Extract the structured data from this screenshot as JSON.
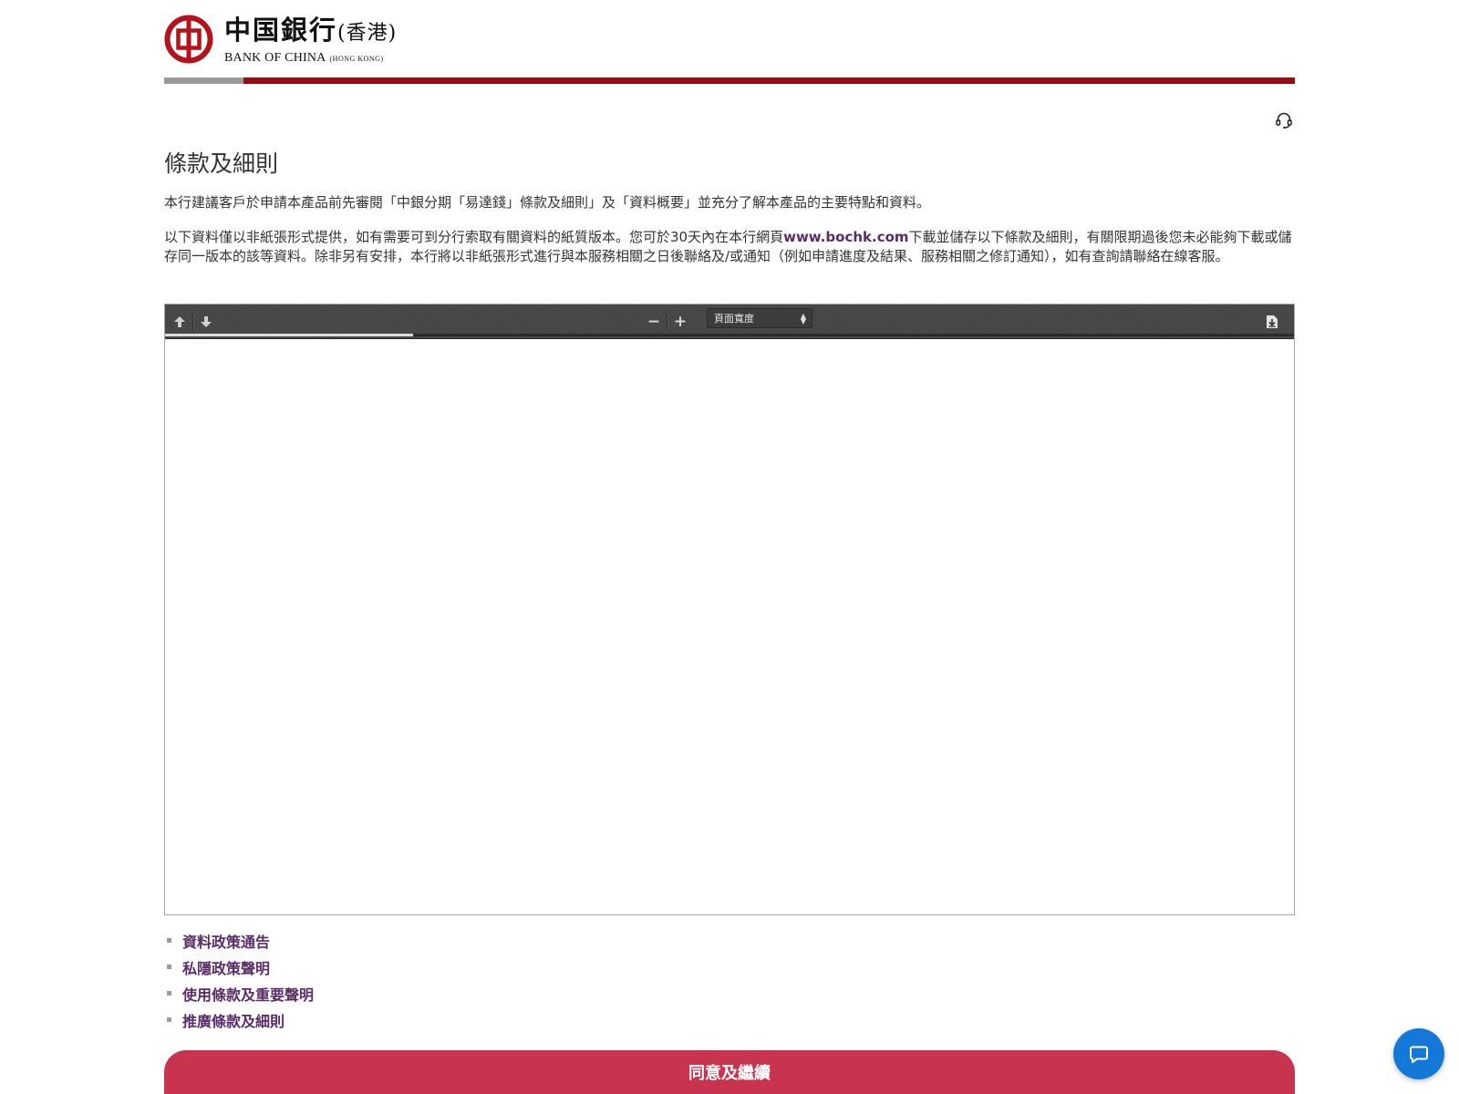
{
  "header": {
    "brand_cn": "中国銀行",
    "brand_cn_region": "(香港)",
    "brand_en": "BANK OF CHINA",
    "brand_en_region": "(HONG KONG)",
    "progress_fraction": 0.07
  },
  "page": {
    "title": "條款及細則",
    "intro": "本行建議客戶於申請本產品前先審閱「中銀分期「易達錢」條款及細則」及「資料概要」並充分了解本產品的主要特點和資料。",
    "notice_before_link": "以下資料僅以非紙張形式提供，如有需要可到分行索取有關資料的紙質版本。您可於30天內在本行網頁",
    "notice_link": "www.bochk.com",
    "notice_after_link": "下載並儲存以下條款及細則，有關限期過後您未必能夠下載或儲存同一版本的該等資料。除非另有安排，本行將以非紙張形式進行與本服務相關之日後聯絡及/或通知（例如申請進度及結果、服務相關之修訂通知），如有查詢請聯絡在線客服。"
  },
  "pdf_viewer": {
    "zoom_value": "頁面寬度",
    "zoom_out_label": "−",
    "zoom_in_label": "+",
    "load_progress_fraction": 0.22
  },
  "links": [
    {
      "label": "資料政策通告"
    },
    {
      "label": "私隱政策聲明"
    },
    {
      "label": "使用條款及重要聲明"
    },
    {
      "label": "推廣條款及細則"
    }
  ],
  "actions": {
    "agree_label": "同意及繼續"
  },
  "colors": {
    "brand_red": "#9b0a12",
    "link_purple": "#5a2d6a",
    "button_red": "#c8334f",
    "chat_blue": "#1378d8"
  },
  "icons": {
    "customer_service": "headset-icon",
    "prev_page": "arrow-up-icon",
    "next_page": "arrow-down-icon",
    "download": "download-icon",
    "chat": "chat-bubble-icon"
  }
}
